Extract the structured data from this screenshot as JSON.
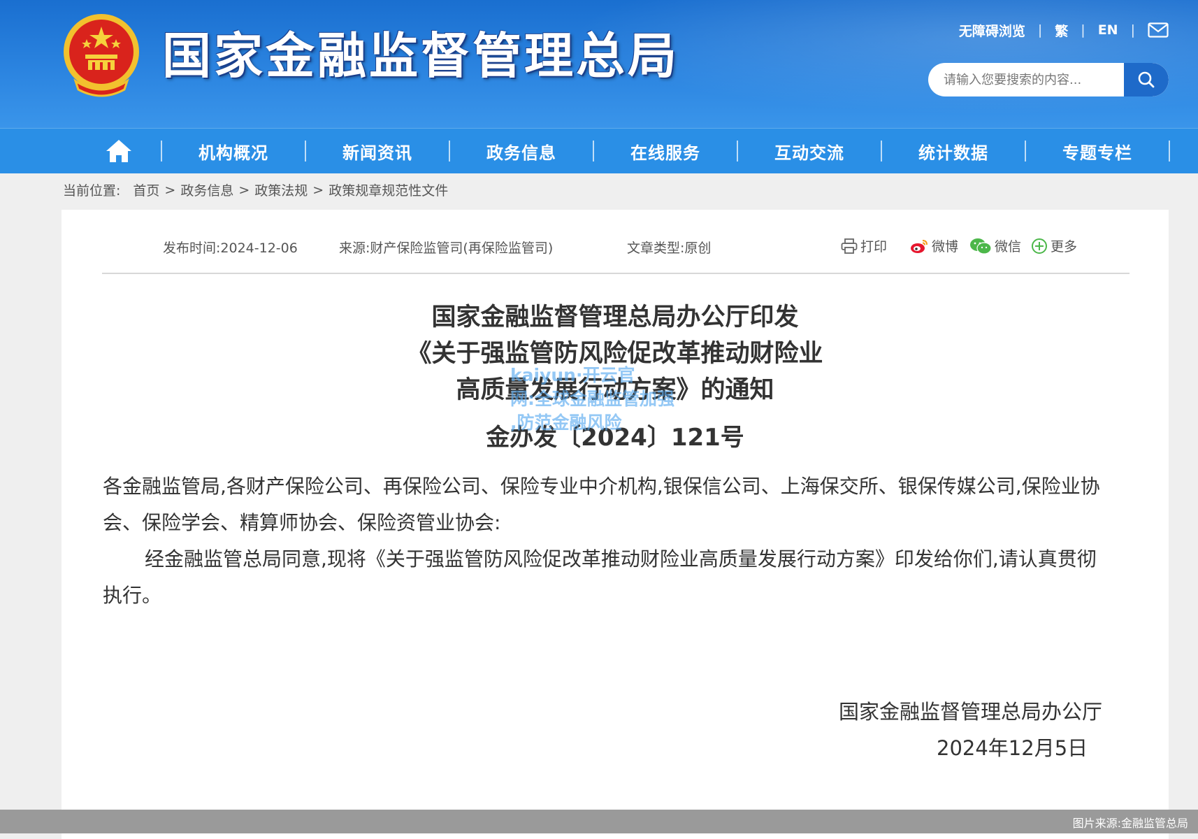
{
  "header": {
    "site_title": "国家金融监督管理总局",
    "links": {
      "accessibility": "无障碍浏览",
      "traditional": "繁",
      "english": "EN"
    },
    "search": {
      "placeholder": "请输入您要搜索的内容..."
    }
  },
  "nav": {
    "items": [
      "机构概况",
      "新闻资讯",
      "政务信息",
      "在线服务",
      "互动交流",
      "统计数据",
      "专题专栏"
    ]
  },
  "breadcrumb": {
    "lead": "当前位置:",
    "items": [
      "首页",
      "政务信息",
      "政策法规",
      "政策规章规范性文件"
    ]
  },
  "meta": {
    "publish": "发布时间:2024-12-06",
    "source": "来源:财产保险监管司(再保险监管司)",
    "type": "文章类型:原创",
    "print": "打印",
    "weibo": "微博",
    "wechat": "微信",
    "more": "更多"
  },
  "document": {
    "title_lines": [
      "国家金融监督管理总局办公厅印发",
      "《关于强监管防风险促改革推动财险业",
      "高质量发展行动方案》的通知"
    ],
    "doc_number": "金办发〔2024〕121号",
    "salutation": "各金融监管局,各财产保险公司、再保险公司、保险专业中介机构,银保信公司、上海保交所、银保传媒公司,保险业协会、保险学会、精算师协会、保险资管业协会:",
    "paragraph": "经金融监管总局同意,现将《关于强监管防风险促改革推动财险业高质量发展行动方案》印发给你们,请认真贯彻执行。",
    "signatory": "国家金融监督管理总局办公厅",
    "date": "2024年12月5日"
  },
  "watermark": {
    "lines": [
      "kaiyun·开云官",
      "网:全球金融监管加强",
      ",防范金融风险"
    ]
  },
  "credit": "图片来源:金融监管总局",
  "colors": {
    "banner": "#2b84e0",
    "nav": "#2a8fe6",
    "search_button": "#1e6ac9"
  }
}
